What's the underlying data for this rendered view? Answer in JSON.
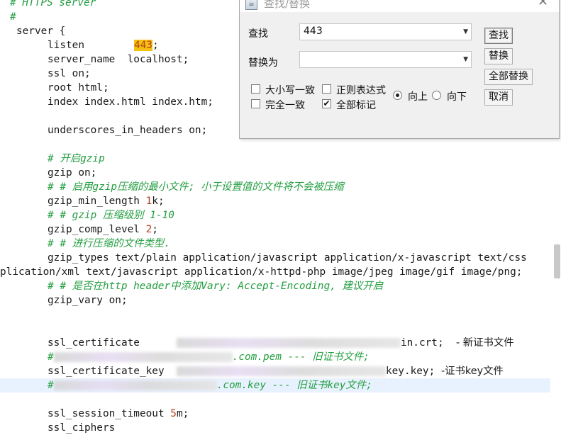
{
  "editor": {
    "lines": {
      "l1": "# HTTPS server",
      "l2": "#",
      "l3": "server {",
      "l4_kw": "listen",
      "l4_val": "443",
      "l4_end": ";",
      "l5": "server_name  localhost;",
      "l6": "ssl on;",
      "l7": "root html;",
      "l8": "index index.html index.htm;",
      "l10": "underscores_in_headers on;",
      "l12": "# 开启gzip",
      "l13": "gzip on;",
      "l14": "# # 启用gzip压缩的最小文件; 小于设置值的文件将不会被压缩",
      "l15_kw": "gzip_min_length ",
      "l15_num": "1",
      "l15_end": "k;",
      "l16": "# # gzip 压缩级别 1-10",
      "l17_kw": "gzip_comp_level ",
      "l17_num": "2",
      "l17_end": ";",
      "l18": "# # 进行压缩的文件类型.",
      "l19": "gzip_types text/plain application/javascript application/x-javascript text/css",
      "l20": "plication/xml text/javascript application/x-httpd-php image/jpeg image/gif image/png;",
      "l21": "# # 是否在http header中添加Vary: Accept-Encoding, 建议开启",
      "l22": "gzip_vary on;",
      "l25_kw": "ssl_certificate",
      "l25_tail": "in.crt;",
      "l25_note": "- 新证书文件",
      "l26_pre": "#",
      "l26_tail": ".com.pem --- 旧证书文件;",
      "l27_kw": "ssl_certificate_key  ",
      "l27_tail": "key.key;",
      "l27_note": "-证书key文件",
      "l28_pre": "#",
      "l28_tail": ".com.key --- 旧证书key文件;",
      "l30_kw": "ssl_session_timeout ",
      "l30_num": "5",
      "l30_end": "m;",
      "l31": "ssl_ciphers"
    }
  },
  "dialog": {
    "title": "查找/替换",
    "find_label": "查找",
    "find_value": "443",
    "replace_label": "替换为",
    "replace_value": "",
    "options": {
      "match_case": {
        "label": "大小写一致",
        "checked": false
      },
      "regex": {
        "label": "正则表达式",
        "checked": false
      },
      "whole_word": {
        "label": "完全一致",
        "checked": false
      },
      "mark_all": {
        "label": "全部标记",
        "checked": true
      },
      "dir_up": {
        "label": "向上",
        "selected": true
      },
      "dir_down": {
        "label": "向下",
        "selected": false
      }
    },
    "buttons": {
      "find": "查找",
      "replace": "替换",
      "replace_all": "全部替换",
      "cancel": "取消"
    }
  }
}
